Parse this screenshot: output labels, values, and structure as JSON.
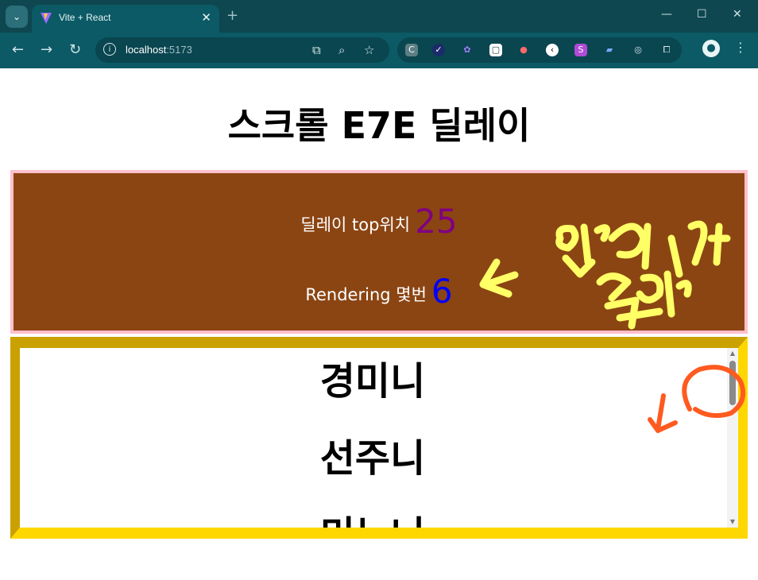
{
  "browser": {
    "tab_title": "Vite + React",
    "url_host": "localhost",
    "url_port": ":5173",
    "theme_color": "#0b5a66"
  },
  "page": {
    "title": "스크롤 E7E 딜레이",
    "delay_label": "딜레이 top위치",
    "delay_value": "25",
    "render_label": "Rendering 몇번",
    "render_value": "6",
    "info_bg_color": "#8b4513",
    "info_border_color": "#ffc0cb",
    "scroll_border_color": "#ffd700"
  },
  "list": {
    "items": [
      "경미니",
      "선주니",
      "미누니"
    ]
  },
  "icons": {
    "tab_search": "chevron-down-icon",
    "close": "close-icon",
    "back": "back-arrow-icon",
    "forward": "forward-arrow-icon",
    "reload": "reload-icon",
    "info": "info-icon",
    "translate": "translate-icon",
    "zoom": "zoom-icon",
    "bookmark": "star-icon",
    "extensions": "puzzle-icon",
    "profile": "profile-icon",
    "menu": "more-vert-icon"
  }
}
